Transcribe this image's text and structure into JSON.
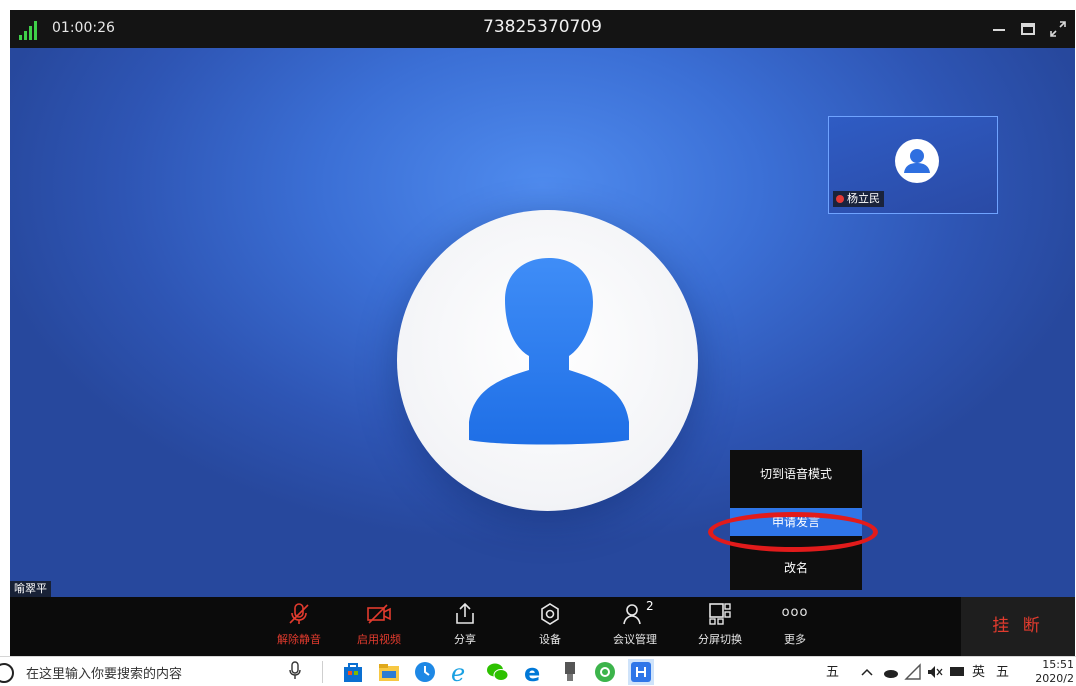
{
  "titlebar": {
    "elapsed_time": "01:00:26",
    "meeting_id": "73825370709",
    "signal_color": "#3fcf49"
  },
  "stage": {
    "remote_participant_name": "杨立民",
    "local_participant_name": "喻翠平",
    "remote_muted_indicator_color": "#e53935"
  },
  "context_menu": {
    "items": [
      {
        "label": "切到语音模式",
        "active": false
      },
      {
        "label": "申请发言",
        "active": true
      },
      {
        "label": "改名",
        "active": false
      }
    ],
    "highlight_color": "#e21b1b"
  },
  "toolbar": {
    "unmute_label": "解除静音",
    "start_video_label": "启用视频",
    "share_label": "分享",
    "settings_label": "设备",
    "participants_label": "会议管理",
    "participants_count": "2",
    "layout_label": "分屏切换",
    "more_label": "更多",
    "more_glyph": "ooo",
    "hangup_label": "挂 断",
    "alert_color": "#e23b2e"
  },
  "taskbar": {
    "search_placeholder": "在这里输入你要搜索的内容",
    "ime_label": "五",
    "lang_label": "英",
    "ime_label_2": "五",
    "time": "15:51",
    "date": "2020/2"
  }
}
